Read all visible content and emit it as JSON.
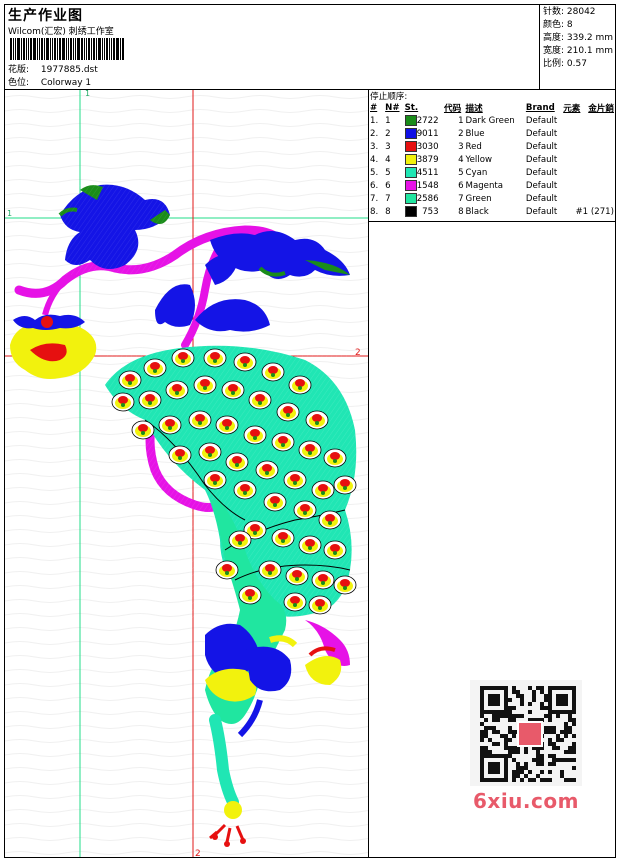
{
  "header": {
    "title": "生产作业图",
    "subtitle": "Wilcom(汇宏) 刺绣工作室",
    "design_label": "花版:",
    "design_value": "1977885.dst",
    "colorway_label": "色位:",
    "colorway_value": "Colorway 1"
  },
  "stats": {
    "stitches": "针数: 28042",
    "colors": "颜色: 8",
    "height": "高度: 339.2 mm",
    "width": "宽度: 210.1 mm",
    "scale": "比例: 0.57"
  },
  "guides": {
    "h1": "1",
    "v1_top": "1",
    "h2": "2",
    "v2_bottom": "2"
  },
  "panel": {
    "title": "停止顺序:",
    "headers": [
      "#",
      "N#",
      "St.",
      "代码",
      "描述",
      "Brand",
      "元素",
      "金片銷"
    ],
    "rows": [
      {
        "idx": "1.",
        "n": "1",
        "swatch": "#1a8c1a",
        "st": "2722",
        "code": "1",
        "desc": "Dark Green",
        "brand": "Default",
        "elem": ""
      },
      {
        "idx": "2.",
        "n": "2",
        "swatch": "#1010e6",
        "st": "9011",
        "code": "2",
        "desc": "Blue",
        "brand": "Default",
        "elem": ""
      },
      {
        "idx": "3.",
        "n": "3",
        "swatch": "#e61010",
        "st": "3030",
        "code": "3",
        "desc": "Red",
        "brand": "Default",
        "elem": ""
      },
      {
        "idx": "4.",
        "n": "4",
        "swatch": "#f2f20d",
        "st": "3879",
        "code": "4",
        "desc": "Yellow",
        "brand": "Default",
        "elem": ""
      },
      {
        "idx": "5.",
        "n": "5",
        "swatch": "#20e6b4",
        "st": "4511",
        "code": "5",
        "desc": "Cyan",
        "brand": "Default",
        "elem": ""
      },
      {
        "idx": "6.",
        "n": "6",
        "swatch": "#e612e6",
        "st": "1548",
        "code": "6",
        "desc": "Magenta",
        "brand": "Default",
        "elem": ""
      },
      {
        "idx": "7.",
        "n": "7",
        "swatch": "#20e6a0",
        "st": "2586",
        "code": "7",
        "desc": "Green",
        "brand": "Default",
        "elem": ""
      },
      {
        "idx": "8.",
        "n": "8",
        "swatch": "#000000",
        "st": "753",
        "code": "8",
        "desc": "Black",
        "brand": "Default",
        "elem": "#1 (271)"
      }
    ]
  },
  "watermark": "6xiu.com"
}
